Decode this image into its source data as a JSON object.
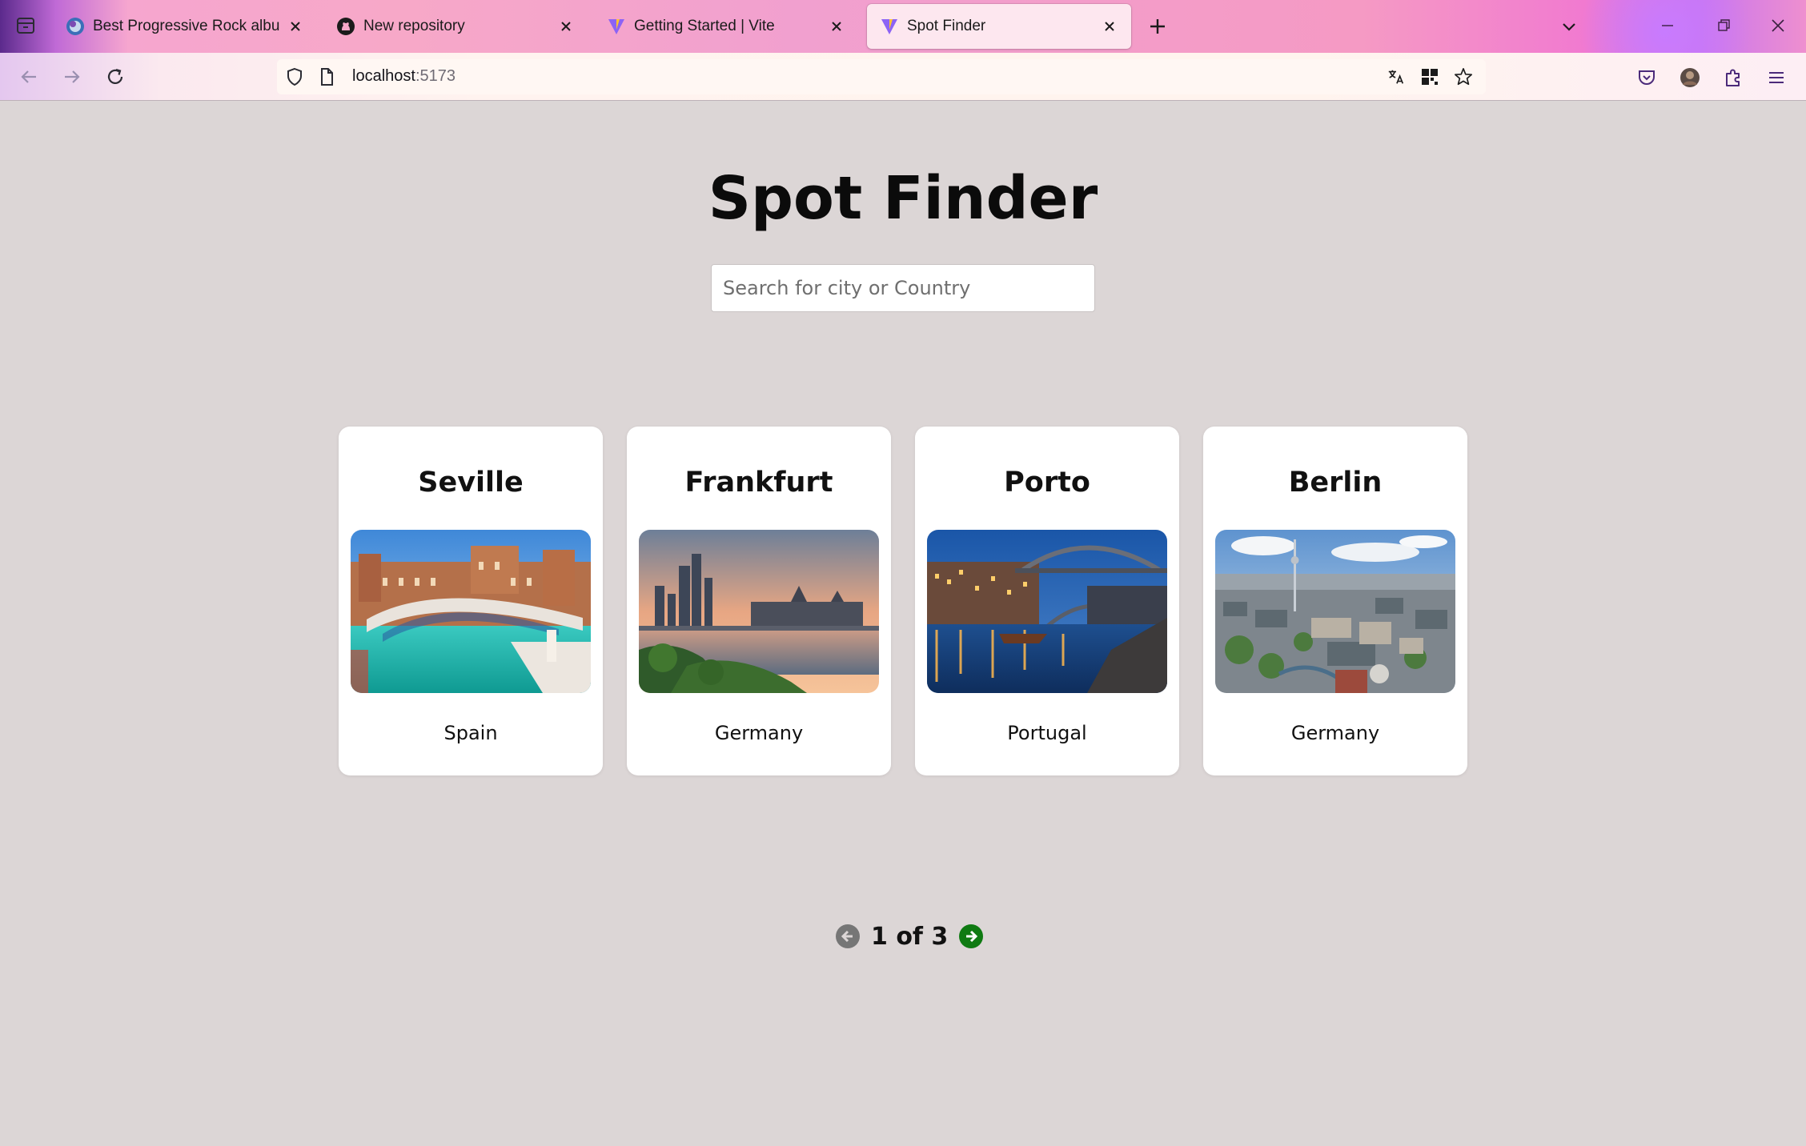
{
  "browser": {
    "tabs": [
      {
        "title": "Best Progressive Rock albums o",
        "icon": "album-favicon-icon",
        "active": false
      },
      {
        "title": "New repository",
        "icon": "github-icon",
        "active": false
      },
      {
        "title": "Getting Started | Vite",
        "icon": "vite-icon",
        "active": false
      },
      {
        "title": "Spot Finder",
        "icon": "vite-icon",
        "active": true
      }
    ],
    "url_host": "localhost",
    "url_port": ":5173"
  },
  "app": {
    "title": "Spot Finder",
    "search_placeholder": "Search for city or Country",
    "search_value": ""
  },
  "cards": [
    {
      "city": "Seville",
      "country": "Spain",
      "image": "plaza-de-espana-photo"
    },
    {
      "city": "Frankfurt",
      "country": "Germany",
      "image": "frankfurt-skyline-photo"
    },
    {
      "city": "Porto",
      "country": "Portugal",
      "image": "porto-bridge-night-photo"
    },
    {
      "city": "Berlin",
      "country": "Germany",
      "image": "berlin-aerial-photo"
    }
  ],
  "pagination": {
    "label": "1 of 3",
    "current": 1,
    "total": 3
  },
  "colors": {
    "page_bg": "#dcd6d6",
    "next_enabled": "#0f7a12",
    "prev_disabled": "#767676"
  }
}
